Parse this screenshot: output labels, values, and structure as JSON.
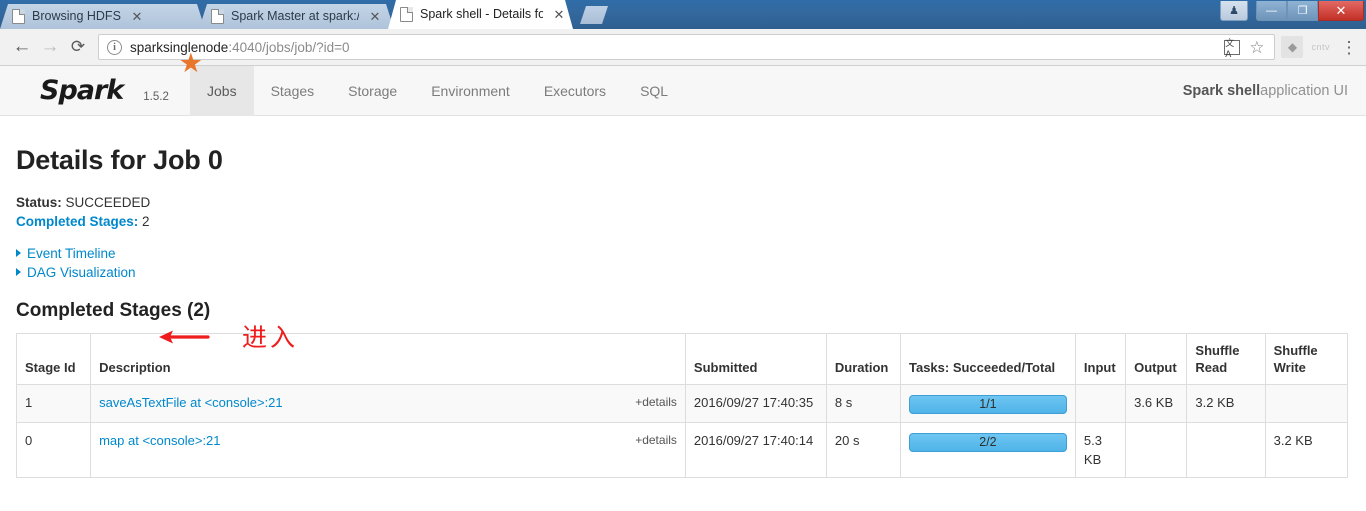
{
  "browser": {
    "tabs": [
      {
        "title": "Browsing HDFS",
        "active": false
      },
      {
        "title": "Spark Master at spark:/",
        "active": false
      },
      {
        "title": "Spark shell - Details for",
        "active": true
      }
    ],
    "close_glyph": "✕",
    "back_glyph": "←",
    "forward_glyph": "→",
    "reload_glyph": "⟳",
    "info_glyph": "i",
    "url_host": "sparksinglenode",
    "url_rest": ":4040/jobs/job/?id=0",
    "translate_glyph": "文A",
    "star_glyph": "☆",
    "ext_glyph": "◆",
    "ext_label": "cntv",
    "menu_glyph": "⋮",
    "window": {
      "person_glyph": "♟",
      "minimize_glyph": "—",
      "maximize_glyph": "❐",
      "close_glyph": "✕"
    }
  },
  "navbar": {
    "brand": "Spark",
    "star_glyph": "★",
    "version": "1.5.2",
    "items": [
      {
        "label": "Jobs",
        "active": true
      },
      {
        "label": "Stages",
        "active": false
      },
      {
        "label": "Storage",
        "active": false
      },
      {
        "label": "Environment",
        "active": false
      },
      {
        "label": "Executors",
        "active": false
      },
      {
        "label": "SQL",
        "active": false
      }
    ],
    "app_name": "Spark shell",
    "app_suffix": " application UI"
  },
  "main": {
    "title": "Details for Job 0",
    "status_label": "Status:",
    "status_value": " SUCCEEDED",
    "completed_stages_label": "Completed Stages:",
    "completed_stages_value": " 2",
    "event_timeline": "Event Timeline",
    "dag_visualization": "DAG Visualization",
    "annotation_text": "进入",
    "annotation_color": "#ee1c1c",
    "section_title": "Completed Stages (2)"
  },
  "table": {
    "headers": {
      "stage_id": "Stage Id",
      "description": "Description",
      "submitted": "Submitted",
      "duration": "Duration",
      "tasks": "Tasks: Succeeded/Total",
      "input": "Input",
      "output": "Output",
      "shuffle_read": "Shuffle Read",
      "shuffle_write": "Shuffle Write"
    },
    "details_label": "+details",
    "rows": [
      {
        "stage_id": "1",
        "description": "saveAsTextFile at <console>:21",
        "submitted": "2016/09/27 17:40:35",
        "duration": "8 s",
        "tasks": "1/1",
        "tasks_pct": 100,
        "input": "",
        "output": "3.6 KB",
        "shuffle_read": "3.2 KB",
        "shuffle_write": ""
      },
      {
        "stage_id": "0",
        "description": "map at <console>:21",
        "submitted": "2016/09/27 17:40:14",
        "duration": "20 s",
        "tasks": "2/2",
        "tasks_pct": 100,
        "input": "5.3 KB",
        "output": "",
        "shuffle_read": "",
        "shuffle_write": "3.2 KB"
      }
    ]
  },
  "colors": {
    "link": "#0088cc",
    "progress": "#5bbdea",
    "brand_star": "#e8762c",
    "annotation": "#ee1c1c"
  }
}
